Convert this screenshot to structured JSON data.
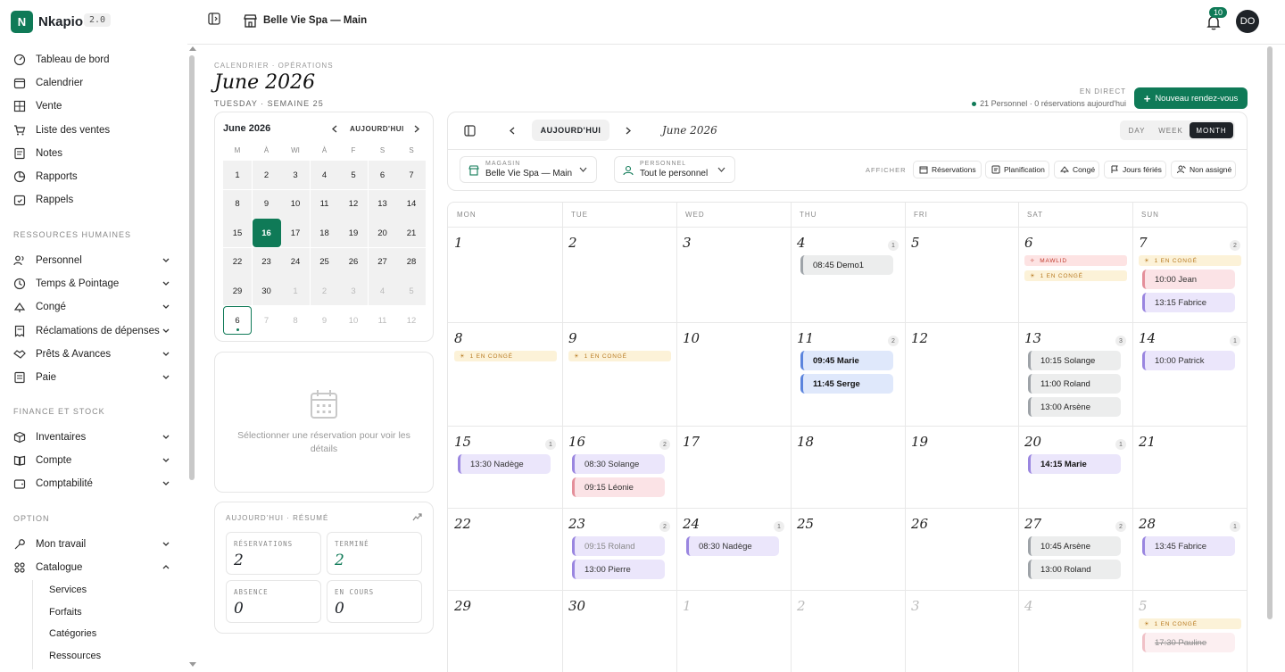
{
  "app": {
    "name": "Nkapio",
    "version": "2.0",
    "logo_letter": "N"
  },
  "sidebar": {
    "main_items": [
      {
        "label": "Tableau de bord",
        "icon": "dashboard-icon"
      },
      {
        "label": "Calendrier",
        "icon": "calendar-icon"
      },
      {
        "label": "Vente",
        "icon": "grid-icon"
      },
      {
        "label": "Liste des ventes",
        "icon": "cart-icon"
      },
      {
        "label": "Notes",
        "icon": "notes-icon"
      },
      {
        "label": "Rapports",
        "icon": "pie-chart-icon"
      },
      {
        "label": "Rappels",
        "icon": "reminder-icon"
      }
    ],
    "hr_title": "RESSOURCES HUMAINES",
    "hr_items": [
      {
        "label": "Personnel",
        "icon": "users-icon"
      },
      {
        "label": "Temps & Pointage",
        "icon": "clock-icon"
      },
      {
        "label": "Congé",
        "icon": "leave-icon"
      },
      {
        "label": "Réclamations de dépenses",
        "icon": "receipt-icon"
      },
      {
        "label": "Prêts & Avances",
        "icon": "handshake-icon"
      },
      {
        "label": "Paie",
        "icon": "payroll-icon"
      }
    ],
    "finance_title": "FINANCE ET STOCK",
    "finance_items": [
      {
        "label": "Inventaires",
        "icon": "box-icon"
      },
      {
        "label": "Compte",
        "icon": "book-icon"
      },
      {
        "label": "Comptabilité",
        "icon": "wallet-icon"
      }
    ],
    "option_title": "OPTION",
    "option_items": [
      {
        "label": "Mon travail",
        "icon": "wrench-icon"
      },
      {
        "label": "Catalogue",
        "icon": "catalog-icon"
      }
    ],
    "catalogue_sub": [
      "Services",
      "Forfaits",
      "Catégories",
      "Ressources"
    ]
  },
  "topbar": {
    "store": "Belle Vie Spa — Main",
    "notifications": "10",
    "avatar": "DO"
  },
  "header": {
    "breadcrumb": "CALENDRIER · OPÉRATIONS",
    "title": "June 2026",
    "subtitle": "TUESDAY · SEMAINE 25",
    "live": "EN DIRECT",
    "summary": "21 Personnel · 0 réservations aujourd'hui",
    "new_button": "Nouveau rendez-vous"
  },
  "mini_calendar": {
    "title": "June 2026",
    "today_label": "AUJOURD'HUI",
    "weekdays": [
      "M",
      "À",
      "WI",
      "À",
      "F",
      "S",
      "S"
    ],
    "days": [
      "1",
      "2",
      "3",
      "4",
      "5",
      "6",
      "7",
      "8",
      "9",
      "10",
      "11",
      "12",
      "13",
      "14",
      "15",
      "16",
      "17",
      "18",
      "19",
      "20",
      "21",
      "22",
      "23",
      "24",
      "25",
      "26",
      "27",
      "28",
      "29",
      "30",
      "1",
      "2",
      "3",
      "4",
      "5",
      "6",
      "7",
      "8",
      "9",
      "10",
      "11",
      "12"
    ],
    "selected": "16",
    "current": "6"
  },
  "detail_panel": {
    "empty": "Sélectionner une réservation pour voir les détails"
  },
  "today_summary": {
    "title": "AUJOURD'HUI · RÉSUMÉ",
    "stats": [
      {
        "label": "RÉSERVATIONS",
        "value": "2",
        "color": "#1f2328"
      },
      {
        "label": "TERMINÉ",
        "value": "2",
        "color": "#0f7a57"
      },
      {
        "label": "ABSENCE",
        "value": "0",
        "color": "#1f2328"
      },
      {
        "label": "EN COURS",
        "value": "0",
        "color": "#1f2328"
      }
    ]
  },
  "toolbar": {
    "today": "AUJOURD'HUI",
    "month": "June 2026",
    "views": [
      "DAY",
      "WEEK",
      "MONTH"
    ],
    "active_view": "MONTH",
    "store_label": "MAGASIN",
    "store_value": "Belle Vie Spa — Main",
    "staff_label": "PERSONNEL",
    "staff_value": "Tout le personnel",
    "show_label": "AFFICHER",
    "chips": [
      "Réservations",
      "Planification",
      "Congé",
      "Jours fériés",
      "Non assigné"
    ]
  },
  "month_grid": {
    "weekdays": [
      "MON",
      "TUE",
      "WED",
      "THU",
      "FRI",
      "SAT",
      "SUN"
    ],
    "days": [
      {
        "n": "1"
      },
      {
        "n": "2"
      },
      {
        "n": "3"
      },
      {
        "n": "4",
        "count": "1",
        "events": [
          {
            "t": "08:45 Demo1",
            "c": "gray"
          }
        ]
      },
      {
        "n": "5"
      },
      {
        "n": "6",
        "tags": [
          {
            "t": "MAWLID",
            "c": "holiday"
          },
          {
            "t": "1 EN CONGÉ",
            "c": "leave"
          }
        ]
      },
      {
        "n": "7",
        "count": "2",
        "tags": [
          {
            "t": "1 EN CONGÉ",
            "c": "leave"
          }
        ],
        "events": [
          {
            "t": "10:00 Jean",
            "c": "pink"
          },
          {
            "t": "13:15 Fabrice",
            "c": "purple"
          }
        ]
      },
      {
        "n": "8",
        "tags": [
          {
            "t": "1 EN CONGÉ",
            "c": "leave"
          }
        ]
      },
      {
        "n": "9",
        "tags": [
          {
            "t": "1 EN CONGÉ",
            "c": "leave"
          }
        ]
      },
      {
        "n": "10"
      },
      {
        "n": "11",
        "count": "2",
        "events": [
          {
            "t": "09:45 Marie",
            "c": "blue"
          },
          {
            "t": "11:45 Serge",
            "c": "blue"
          }
        ]
      },
      {
        "n": "12"
      },
      {
        "n": "13",
        "count": "3",
        "events": [
          {
            "t": "10:15 Solange",
            "c": "gray"
          },
          {
            "t": "11:00 Roland",
            "c": "gray"
          },
          {
            "t": "13:00 Arsène",
            "c": "gray"
          }
        ]
      },
      {
        "n": "14",
        "count": "1",
        "events": [
          {
            "t": "10:00 Patrick",
            "c": "purple"
          }
        ]
      },
      {
        "n": "15",
        "count": "1",
        "events": [
          {
            "t": "13:30 Nadège",
            "c": "purple"
          }
        ]
      },
      {
        "n": "16",
        "count": "2",
        "events": [
          {
            "t": "08:30 Solange",
            "c": "purple"
          },
          {
            "t": "09:15 Léonie",
            "c": "pink"
          }
        ]
      },
      {
        "n": "17"
      },
      {
        "n": "18"
      },
      {
        "n": "19"
      },
      {
        "n": "20",
        "count": "1",
        "events": [
          {
            "t": "14:15 Marie",
            "c": "purple-bold"
          }
        ]
      },
      {
        "n": "21"
      },
      {
        "n": "22"
      },
      {
        "n": "23",
        "count": "2",
        "events": [
          {
            "t": "09:15 Roland",
            "c": "purple-muted"
          },
          {
            "t": "13:00 Pierre",
            "c": "purple"
          }
        ]
      },
      {
        "n": "24",
        "count": "1",
        "events": [
          {
            "t": "08:30 Nadège",
            "c": "purple"
          }
        ]
      },
      {
        "n": "25"
      },
      {
        "n": "26"
      },
      {
        "n": "27",
        "count": "2",
        "events": [
          {
            "t": "10:45 Arsène",
            "c": "gray"
          },
          {
            "t": "13:00 Roland",
            "c": "gray"
          }
        ]
      },
      {
        "n": "28",
        "count": "1",
        "events": [
          {
            "t": "13:45 Fabrice",
            "c": "purple"
          }
        ]
      },
      {
        "n": "29"
      },
      {
        "n": "30"
      },
      {
        "n": "1",
        "out": true
      },
      {
        "n": "2",
        "out": true
      },
      {
        "n": "3",
        "out": true
      },
      {
        "n": "4",
        "out": true
      },
      {
        "n": "5",
        "out": true,
        "tags": [
          {
            "t": "1 EN CONGÉ",
            "c": "leave"
          }
        ],
        "events": [
          {
            "t": "17:30 Pauline",
            "c": "pink-faded"
          }
        ]
      }
    ]
  },
  "colors": {
    "accent": "#0f7a57",
    "dark": "#1f2328"
  }
}
